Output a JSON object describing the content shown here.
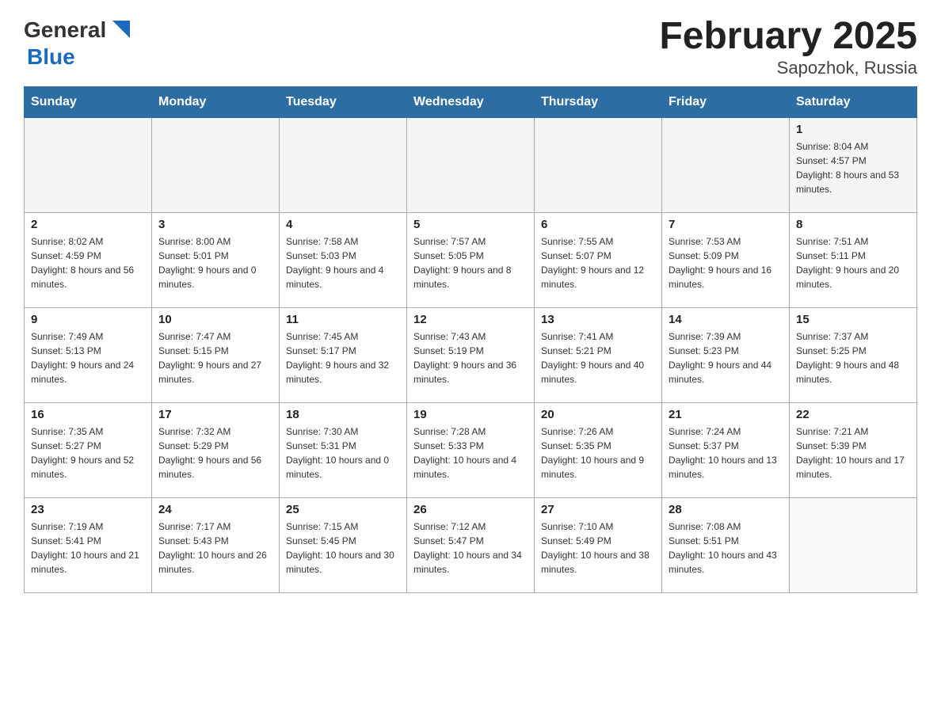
{
  "header": {
    "logo_general": "General",
    "logo_blue": "Blue",
    "month_title": "February 2025",
    "location": "Sapozhok, Russia"
  },
  "weekdays": [
    "Sunday",
    "Monday",
    "Tuesday",
    "Wednesday",
    "Thursday",
    "Friday",
    "Saturday"
  ],
  "weeks": [
    [
      {
        "day": "",
        "info": ""
      },
      {
        "day": "",
        "info": ""
      },
      {
        "day": "",
        "info": ""
      },
      {
        "day": "",
        "info": ""
      },
      {
        "day": "",
        "info": ""
      },
      {
        "day": "",
        "info": ""
      },
      {
        "day": "1",
        "info": "Sunrise: 8:04 AM\nSunset: 4:57 PM\nDaylight: 8 hours and 53 minutes."
      }
    ],
    [
      {
        "day": "2",
        "info": "Sunrise: 8:02 AM\nSunset: 4:59 PM\nDaylight: 8 hours and 56 minutes."
      },
      {
        "day": "3",
        "info": "Sunrise: 8:00 AM\nSunset: 5:01 PM\nDaylight: 9 hours and 0 minutes."
      },
      {
        "day": "4",
        "info": "Sunrise: 7:58 AM\nSunset: 5:03 PM\nDaylight: 9 hours and 4 minutes."
      },
      {
        "day": "5",
        "info": "Sunrise: 7:57 AM\nSunset: 5:05 PM\nDaylight: 9 hours and 8 minutes."
      },
      {
        "day": "6",
        "info": "Sunrise: 7:55 AM\nSunset: 5:07 PM\nDaylight: 9 hours and 12 minutes."
      },
      {
        "day": "7",
        "info": "Sunrise: 7:53 AM\nSunset: 5:09 PM\nDaylight: 9 hours and 16 minutes."
      },
      {
        "day": "8",
        "info": "Sunrise: 7:51 AM\nSunset: 5:11 PM\nDaylight: 9 hours and 20 minutes."
      }
    ],
    [
      {
        "day": "9",
        "info": "Sunrise: 7:49 AM\nSunset: 5:13 PM\nDaylight: 9 hours and 24 minutes."
      },
      {
        "day": "10",
        "info": "Sunrise: 7:47 AM\nSunset: 5:15 PM\nDaylight: 9 hours and 27 minutes."
      },
      {
        "day": "11",
        "info": "Sunrise: 7:45 AM\nSunset: 5:17 PM\nDaylight: 9 hours and 32 minutes."
      },
      {
        "day": "12",
        "info": "Sunrise: 7:43 AM\nSunset: 5:19 PM\nDaylight: 9 hours and 36 minutes."
      },
      {
        "day": "13",
        "info": "Sunrise: 7:41 AM\nSunset: 5:21 PM\nDaylight: 9 hours and 40 minutes."
      },
      {
        "day": "14",
        "info": "Sunrise: 7:39 AM\nSunset: 5:23 PM\nDaylight: 9 hours and 44 minutes."
      },
      {
        "day": "15",
        "info": "Sunrise: 7:37 AM\nSunset: 5:25 PM\nDaylight: 9 hours and 48 minutes."
      }
    ],
    [
      {
        "day": "16",
        "info": "Sunrise: 7:35 AM\nSunset: 5:27 PM\nDaylight: 9 hours and 52 minutes."
      },
      {
        "day": "17",
        "info": "Sunrise: 7:32 AM\nSunset: 5:29 PM\nDaylight: 9 hours and 56 minutes."
      },
      {
        "day": "18",
        "info": "Sunrise: 7:30 AM\nSunset: 5:31 PM\nDaylight: 10 hours and 0 minutes."
      },
      {
        "day": "19",
        "info": "Sunrise: 7:28 AM\nSunset: 5:33 PM\nDaylight: 10 hours and 4 minutes."
      },
      {
        "day": "20",
        "info": "Sunrise: 7:26 AM\nSunset: 5:35 PM\nDaylight: 10 hours and 9 minutes."
      },
      {
        "day": "21",
        "info": "Sunrise: 7:24 AM\nSunset: 5:37 PM\nDaylight: 10 hours and 13 minutes."
      },
      {
        "day": "22",
        "info": "Sunrise: 7:21 AM\nSunset: 5:39 PM\nDaylight: 10 hours and 17 minutes."
      }
    ],
    [
      {
        "day": "23",
        "info": "Sunrise: 7:19 AM\nSunset: 5:41 PM\nDaylight: 10 hours and 21 minutes."
      },
      {
        "day": "24",
        "info": "Sunrise: 7:17 AM\nSunset: 5:43 PM\nDaylight: 10 hours and 26 minutes."
      },
      {
        "day": "25",
        "info": "Sunrise: 7:15 AM\nSunset: 5:45 PM\nDaylight: 10 hours and 30 minutes."
      },
      {
        "day": "26",
        "info": "Sunrise: 7:12 AM\nSunset: 5:47 PM\nDaylight: 10 hours and 34 minutes."
      },
      {
        "day": "27",
        "info": "Sunrise: 7:10 AM\nSunset: 5:49 PM\nDaylight: 10 hours and 38 minutes."
      },
      {
        "day": "28",
        "info": "Sunrise: 7:08 AM\nSunset: 5:51 PM\nDaylight: 10 hours and 43 minutes."
      },
      {
        "day": "",
        "info": ""
      }
    ]
  ]
}
